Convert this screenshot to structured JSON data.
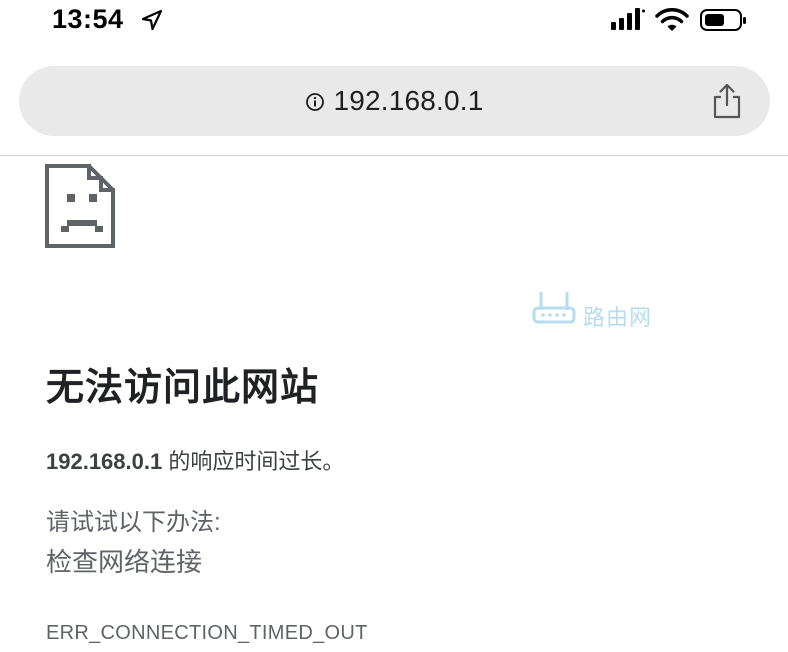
{
  "status_bar": {
    "time": "13:54",
    "icons": [
      "location-arrow-icon",
      "cellular-signal-icon",
      "wifi-icon",
      "battery-icon"
    ]
  },
  "address_bar": {
    "url": "192.168.0.1",
    "leading_icon": "info-icon",
    "trailing_icon": "share-icon"
  },
  "error_page": {
    "icon": "sad-page-icon",
    "title": "无法访问此网站",
    "host": "192.168.0.1",
    "description_suffix": " 的响应时间过长。",
    "suggestions_heading": "请试试以下办法:",
    "suggestions": [
      "检查网络连接"
    ],
    "error_code": "ERR_CONNECTION_TIMED_OUT"
  },
  "watermark": {
    "text": "路由网",
    "color": "#b7dcef"
  },
  "colors": {
    "address_bar_bg": "#e9e9ea",
    "title": "#202124",
    "secondary_text": "#5f6368"
  }
}
